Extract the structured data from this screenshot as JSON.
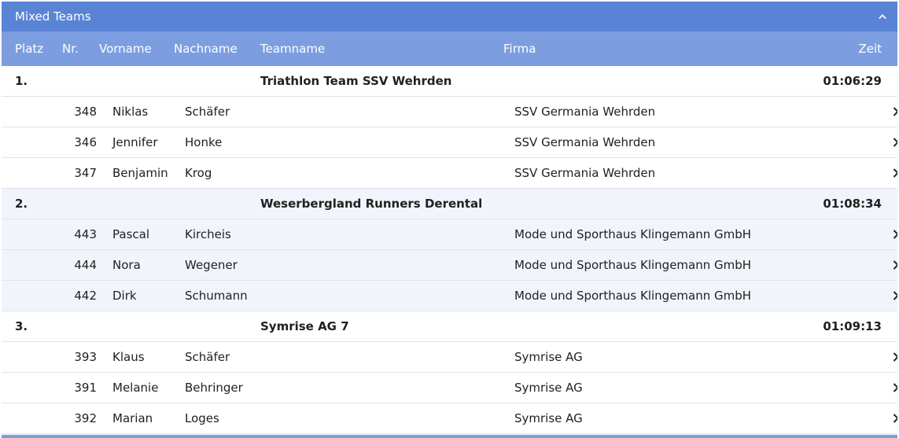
{
  "panel": {
    "title": "Mixed Teams"
  },
  "columns": {
    "platz": "Platz",
    "nr": "Nr.",
    "vorname": "Vorname",
    "nachname": "Nachname",
    "teamname": "Teamname",
    "firma": "Firma",
    "zeit": "Zeit"
  },
  "teams": [
    {
      "platz": "1.",
      "teamname": "Triathlon Team SSV Wehrden",
      "zeit": "01:06:29",
      "members": [
        {
          "nr": "348",
          "vorname": "Niklas",
          "nachname": "Schäfer",
          "firma": "SSV Germania Wehrden"
        },
        {
          "nr": "346",
          "vorname": "Jennifer",
          "nachname": "Honke",
          "firma": "SSV Germania Wehrden"
        },
        {
          "nr": "347",
          "vorname": "Benjamin",
          "nachname": "Krog",
          "firma": "SSV Germania Wehrden"
        }
      ]
    },
    {
      "platz": "2.",
      "teamname": "Weserbergland Runners Derental",
      "zeit": "01:08:34",
      "members": [
        {
          "nr": "443",
          "vorname": "Pascal",
          "nachname": "Kircheis",
          "firma": "Mode und Sporthaus Klingemann GmbH"
        },
        {
          "nr": "444",
          "vorname": "Nora",
          "nachname": "Wegener",
          "firma": "Mode und Sporthaus Klingemann GmbH"
        },
        {
          "nr": "442",
          "vorname": "Dirk",
          "nachname": "Schumann",
          "firma": "Mode und Sporthaus Klingemann GmbH"
        }
      ]
    },
    {
      "platz": "3.",
      "teamname": "Symrise AG 7",
      "zeit": "01:09:13",
      "members": [
        {
          "nr": "393",
          "vorname": "Klaus",
          "nachname": "Schäfer",
          "firma": "Symrise AG"
        },
        {
          "nr": "391",
          "vorname": "Melanie",
          "nachname": "Behringer",
          "firma": "Symrise AG"
        },
        {
          "nr": "392",
          "vorname": "Marian",
          "nachname": "Loges",
          "firma": "Symrise AG"
        }
      ]
    }
  ],
  "icons": {
    "collapse": "chevron-up-icon",
    "row_action": "chevron-right-icon"
  },
  "colors": {
    "header": "#5984d6",
    "column_header": "#7c9ee0",
    "alt_row": "#f1f5fb"
  }
}
